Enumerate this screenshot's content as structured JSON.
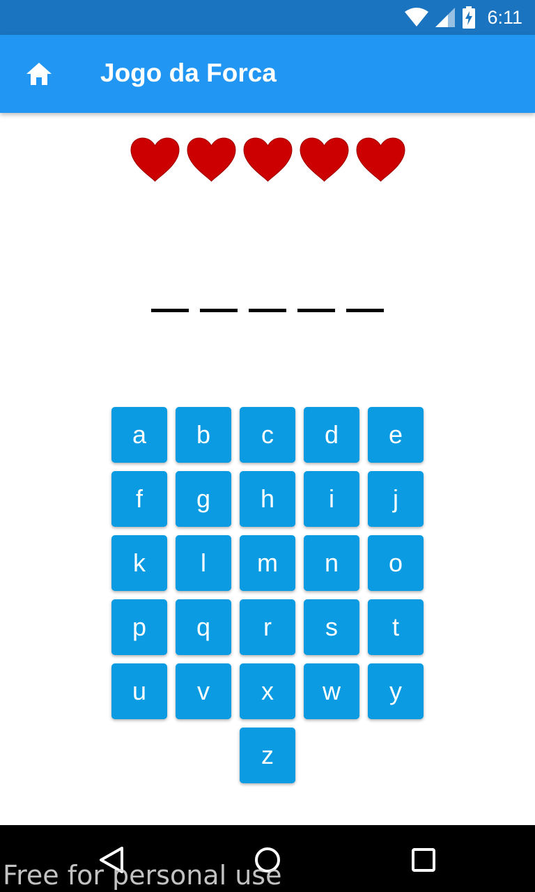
{
  "status_bar": {
    "time": "6:11",
    "icons": [
      "wifi-icon",
      "signal-icon",
      "battery-charging-icon"
    ]
  },
  "app_bar": {
    "title": "Jogo da Forca",
    "home_icon": "home-icon",
    "color": "#2196f3"
  },
  "lives": {
    "remaining": 5,
    "total": 5,
    "heart_color": "#cc0000"
  },
  "word": {
    "slots": [
      "",
      "",
      "",
      "",
      ""
    ]
  },
  "keyboard": {
    "keys": [
      "a",
      "b",
      "c",
      "d",
      "e",
      "f",
      "g",
      "h",
      "i",
      "j",
      "k",
      "l",
      "m",
      "n",
      "o",
      "p",
      "q",
      "r",
      "s",
      "t",
      "u",
      "v",
      "x",
      "w",
      "y",
      "z"
    ],
    "key_color": "#0a9be3"
  },
  "nav_bar": {
    "icons": [
      "back-icon",
      "home-circle-icon",
      "recents-icon"
    ]
  },
  "watermark": "Free for personal use"
}
